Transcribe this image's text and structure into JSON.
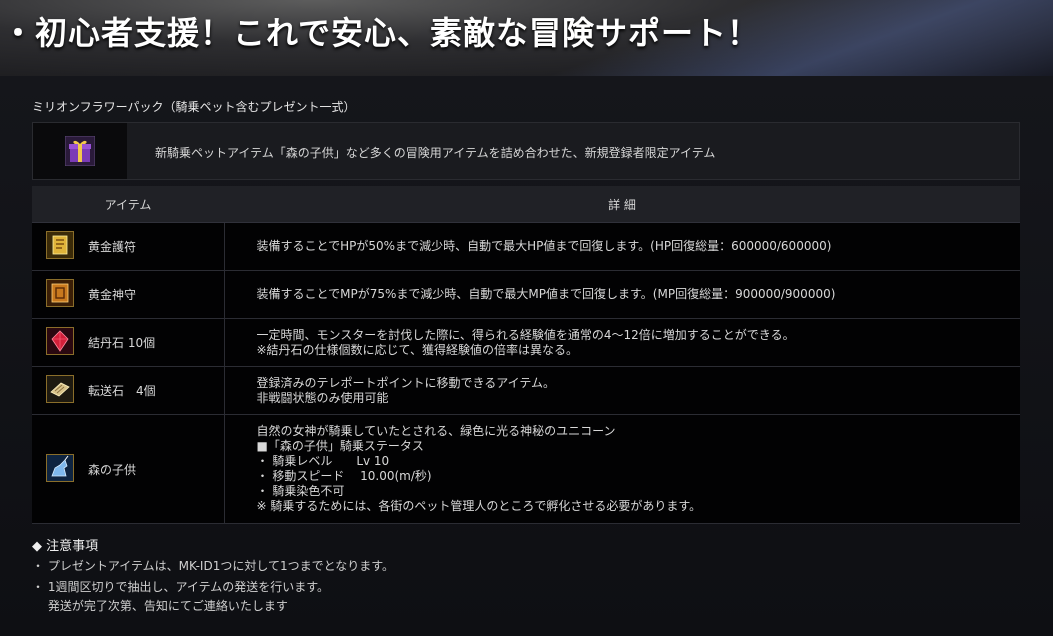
{
  "banner": {
    "title": "・初心者支援！これで安心、素敵な冒険サポート！"
  },
  "pack": {
    "title": "ミリオンフラワーパック（騎乗ペット含むプレゼント一式）",
    "intro": "新騎乗ペットアイテム「森の子供」など多くの冒険用アイテムを詰め合わせた、新規登録者限定アイテム",
    "icon": "gift-box-icon"
  },
  "table": {
    "header_item": "アイテム",
    "header_detail": "詳 細",
    "rows": [
      {
        "icon": "gold-talisman-icon",
        "name": "黄金護符",
        "detail": [
          "装備することでHPが50%まで減少時、自動で最大HP値まで回復します。(HP回復総量：600000/600000)"
        ]
      },
      {
        "icon": "gold-charm-icon",
        "name": "黄金神守",
        "detail": [
          "装備することでMPが75%まで減少時、自動で最大MP値まで回復します。(MP回復総量：900000/900000)"
        ]
      },
      {
        "icon": "red-crystal-icon",
        "name": "結丹石 10個",
        "detail": [
          "一定時間、モンスターを討伐した際に、得られる経験値を通常の4～12倍に増加することができる。",
          "※結丹石の仕様個数に応じて、獲得経験値の倍率は異なる。"
        ]
      },
      {
        "icon": "scroll-icon",
        "name": "転送石　4個",
        "detail": [
          "登録済みのテレポートポイントに移動できるアイテム。",
          "非戦闘状態のみ使用可能"
        ]
      },
      {
        "icon": "unicorn-icon",
        "name": "森の子供",
        "detail": [
          "自然の女神が騎乗していたとされる、緑色に光る神秘のユニコーン",
          "■「森の子供」騎乗ステータス",
          "・ 騎乗レベル　　Lv 10",
          "・ 移動スピード　 10.00(m/秒)",
          "・ 騎乗染色不可",
          "※ 騎乗するためには、各街のペット管理人のところで孵化させる必要があります。"
        ]
      }
    ]
  },
  "notes": {
    "heading": "◆ 注意事項",
    "items": [
      "・ プレゼントアイテムは、MK-ID1つに対して1つまでとなります。",
      "・ 1週間区切りで抽出し、アイテムの発送を行います。",
      "　 発送が完了次第、告知にてご連絡いたします"
    ]
  }
}
